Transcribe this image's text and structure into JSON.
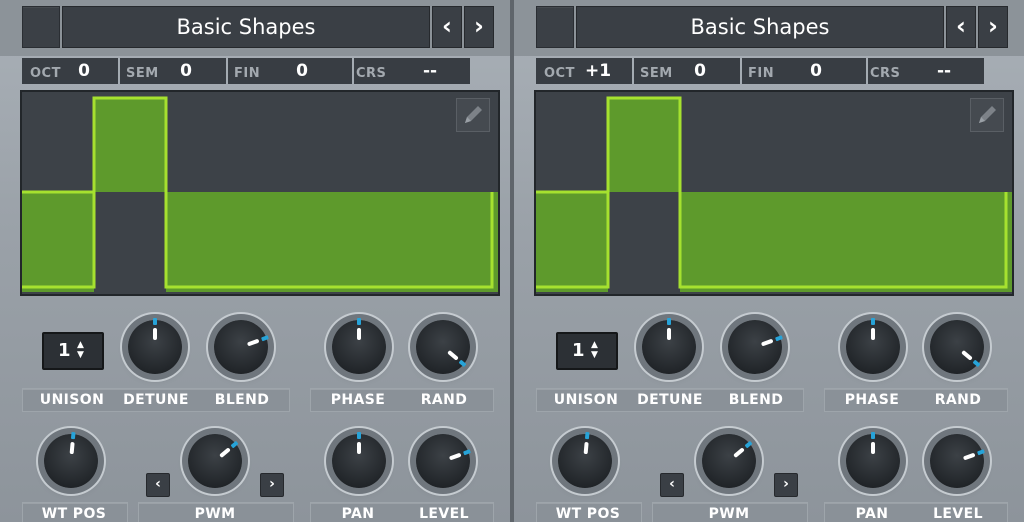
{
  "panels": [
    {
      "preset_name": "Basic Shapes",
      "prev_label": "‹",
      "next_label": "›",
      "tuning": [
        {
          "label": "OCT",
          "value": "0"
        },
        {
          "label": "SEM",
          "value": "0"
        },
        {
          "label": "FIN",
          "value": "0"
        },
        {
          "label": "CRS",
          "value": "--"
        }
      ],
      "wt_edit_icon": "pencil-icon",
      "unison_value": "1",
      "labels": {
        "unison": "UNISON",
        "detune": "DETUNE",
        "blend": "BLEND",
        "phase": "PHASE",
        "rand": "RAND",
        "wt_pos": "WT POS",
        "pwm": "PWM",
        "pan": "PAN",
        "level": "LEVEL"
      },
      "pwm_prev": "‹",
      "pwm_next": "›"
    },
    {
      "preset_name": "Basic Shapes",
      "prev_label": "‹",
      "next_label": "›",
      "tuning": [
        {
          "label": "OCT",
          "value": "+1"
        },
        {
          "label": "SEM",
          "value": "0"
        },
        {
          "label": "FIN",
          "value": "0"
        },
        {
          "label": "CRS",
          "value": "--"
        }
      ],
      "wt_edit_icon": "pencil-icon",
      "unison_value": "1",
      "labels": {
        "unison": "UNISON",
        "detune": "DETUNE",
        "blend": "BLEND",
        "phase": "PHASE",
        "rand": "RAND",
        "wt_pos": "WT POS",
        "pwm": "PWM",
        "pan": "PAN",
        "level": "LEVEL"
      },
      "pwm_prev": "‹",
      "pwm_next": "›"
    }
  ],
  "colors": {
    "waveform_fill": "#5e9a2c",
    "waveform_stroke": "#a6e12f",
    "knob_indicator": "#27a3d8"
  }
}
